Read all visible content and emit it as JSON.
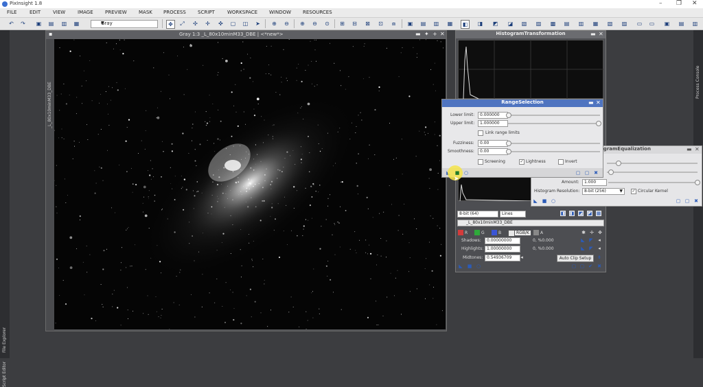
{
  "window": {
    "title": "PixInsight 1.8"
  },
  "menu": [
    "FILE",
    "EDIT",
    "VIEW",
    "IMAGE",
    "PREVIEW",
    "MASK",
    "PROCESS",
    "SCRIPT",
    "WORKSPACE",
    "WINDOW",
    "RESOURCES"
  ],
  "toolbar": {
    "view_select": "Gray"
  },
  "image_window": {
    "title": "Gray 1:3 _L_80x10minM33_DBE | <*new*>",
    "side_label": "_L_80x10minM33_DBE"
  },
  "side_tabs": {
    "left_a": "File Explorer",
    "left_b": "Script Editor",
    "right": "Process Console"
  },
  "histogram": {
    "title": "HistogramTransformation",
    "zoom_select": "8-bit (64)",
    "graph_select": "Lines",
    "view_select": "_L_80x10minM33_DBE",
    "channels": {
      "r": "R",
      "g": "G",
      "b": "B",
      "rgbk": "RGB/K",
      "a": "A"
    },
    "shadows_label": "Shadows:",
    "shadows_value": "0.00000000",
    "shadows_clip": "0, %0.000",
    "highlights_label": "Highlights:",
    "highlights_value": "1.00000000",
    "highlights_clip": "0, %0.000",
    "midtones_label": "Midtones:",
    "midtones_value": "0.54936709",
    "auto_clip_label": "Auto Clip Setup"
  },
  "range_selection": {
    "title": "RangeSelection",
    "lower_label": "Lower limit:",
    "lower_value": "0.000000",
    "upper_label": "Upper limit:",
    "upper_value": "1.000000",
    "link_label": "Link range limits",
    "fuzziness_label": "Fuzziness:",
    "fuzziness_value": "0.00",
    "smoothness_label": "Smoothness:",
    "smoothness_value": "0.00",
    "screening_label": "Screening",
    "lightness_label": "Lightness",
    "invert_label": "Invert"
  },
  "amp_panel": {
    "title": "ogramEqualization",
    "amount_label": "Amount:",
    "amount_value": "1.000",
    "resolution_label": "Histogram Resolution:",
    "resolution_value": "8-bit (256)",
    "kernel_label": "Circular Kernel"
  },
  "colors": {
    "accent_blue": "#4f74c0",
    "highlight_yellow": "#f4e44a",
    "channel_r": "#d43b3b",
    "channel_g": "#2eaa3a",
    "channel_b": "#3a55d6"
  }
}
